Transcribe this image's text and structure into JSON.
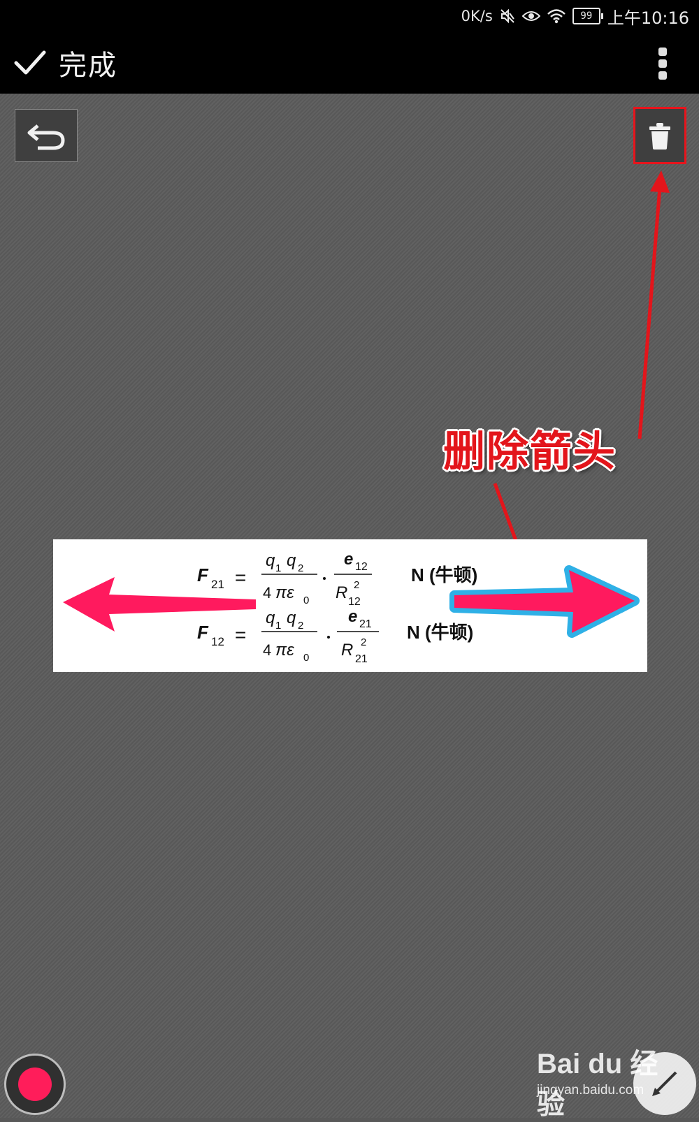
{
  "status_bar": {
    "speed": "0K/s",
    "battery": "99",
    "time": "上午10:16",
    "icons": [
      "mute-icon",
      "eye-icon",
      "wifi-icon",
      "battery-icon"
    ]
  },
  "toolbar": {
    "done_label": "完成",
    "done_icon": "check-icon",
    "more_icon": "more-vertical-icon"
  },
  "tools": {
    "undo_icon": "undo-icon",
    "delete_icon": "trash-icon"
  },
  "annotation": {
    "label": "删除箭头",
    "color": "#e3151b"
  },
  "formula": {
    "line1": {
      "lhs": "F",
      "lhs_sub": "21",
      "num": "q",
      "num_sub1": "1",
      "num_sub2": "2",
      "den": "4",
      "den_pi": "πε",
      "den_sub": "0",
      "vec": "e",
      "vec_sub": "12",
      "vec_den": "R",
      "vec_den_sup": "2",
      "vec_den_sub": "12",
      "unit": "N (牛顿)"
    },
    "line2": {
      "lhs": "F",
      "lhs_sub": "12",
      "num": "q",
      "num_sub1": "1",
      "num_sub2": "2",
      "den": "4",
      "den_pi": "πε",
      "den_sub": "0",
      "vec": "e",
      "vec_sub": "21",
      "vec_den": "R",
      "vec_den_sup": "2",
      "vec_den_sub": "21",
      "unit": "N (牛顿)"
    },
    "arrow_color": "#ff1a5e",
    "selection_color": "#2fb0e6"
  },
  "bottom": {
    "record_color": "#ff1d5a",
    "pen_icon": "pen-icon"
  },
  "watermark": {
    "brand": "Bai du 经验",
    "url": "jingyan.baidu.com"
  }
}
